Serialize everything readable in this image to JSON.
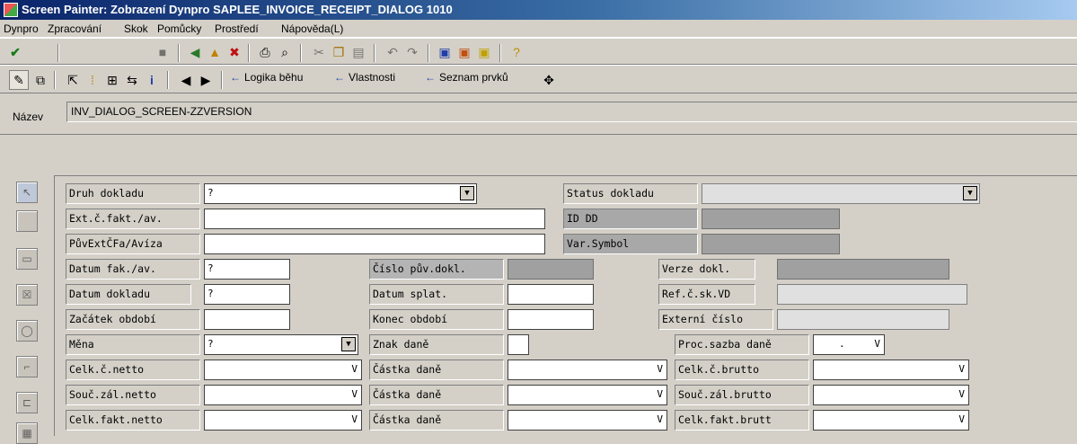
{
  "window": {
    "title": "Screen Painter: Zobrazení Dynpro SAPLEE_INVOICE_RECEIPT_DIALOG 1010"
  },
  "menu": {
    "items": [
      "Dynpro",
      "Zpracování",
      "Skok",
      "Pomůcky",
      "Prostředí",
      "Nápověda(L)"
    ]
  },
  "toolbar2": {
    "cmd_flow_logic": "Logika běhu",
    "cmd_attributes": "Vlastnosti",
    "cmd_element_list": "Seznam prvků"
  },
  "name": {
    "label": "Název",
    "value": "INV_DIALOG_SCREEN-ZZVERSION"
  },
  "icons": {
    "arrow_back": "←",
    "dropdown": "▼",
    "v": "V"
  },
  "form": {
    "druh_dokladu": {
      "label": "Druh dokladu",
      "value": "?"
    },
    "status_dokladu": {
      "label": "Status dokladu",
      "value": ""
    },
    "ext_c_fakt": {
      "label": "Ext.č.fakt./av.",
      "value": ""
    },
    "id_dd": {
      "label": "ID DD",
      "value": ""
    },
    "puv_ext": {
      "label": "PůvExtČFa/Avíza",
      "value": ""
    },
    "var_symbol": {
      "label": "Var.Symbol",
      "value": ""
    },
    "datum_fak": {
      "label": "Datum fak./av.",
      "value": "?"
    },
    "cislo_puv": {
      "label": "Číslo pův.dokl.",
      "value": ""
    },
    "verze_dokl": {
      "label": "Verze dokl.",
      "value": ""
    },
    "datum_dokladu": {
      "label": "Datum dokladu",
      "value": "?"
    },
    "datum_splat": {
      "label": "Datum splat.",
      "value": ""
    },
    "ref_c_sk": {
      "label": "Ref.č.sk.VD",
      "value": ""
    },
    "zacatek": {
      "label": "Začátek období",
      "value": ""
    },
    "konec": {
      "label": "Konec období",
      "value": ""
    },
    "externi_cislo": {
      "label": "Externí číslo",
      "value": ""
    },
    "mena": {
      "label": "Měna",
      "value": "?"
    },
    "znak_dane": {
      "label": "Znak daně",
      "value": ""
    },
    "proc_sazba": {
      "label": "Proc.sazba daně",
      "value": "."
    },
    "celk_netto": {
      "label": "Celk.č.netto",
      "value": ""
    },
    "castka_dane_1": {
      "label": "Částka daně",
      "value": ""
    },
    "celk_brutto": {
      "label": "Celk.č.brutto",
      "value": ""
    },
    "souc_zal_netto": {
      "label": "Souč.zál.netto",
      "value": ""
    },
    "castka_dane_2": {
      "label": "Částka daně",
      "value": ""
    },
    "souc_zal_brutto": {
      "label": "Souč.zál.brutto",
      "value": ""
    },
    "celk_fakt_netto": {
      "label": "Celk.fakt.netto",
      "value": ""
    },
    "castka_dane_3": {
      "label": "Částka daně",
      "value": ""
    },
    "celk_fakt_brutt": {
      "label": "Celk.fakt.brutt",
      "value": ""
    }
  }
}
